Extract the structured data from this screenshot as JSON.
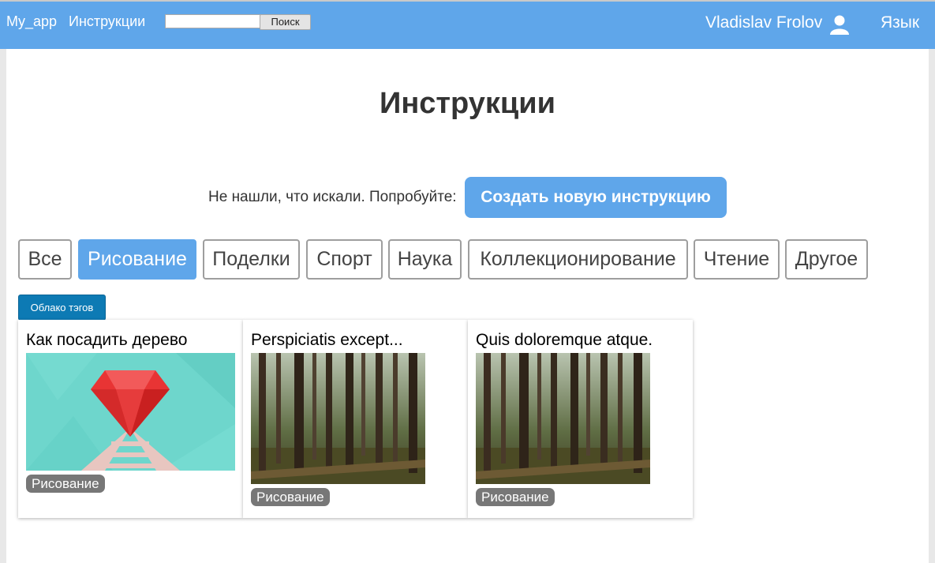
{
  "navbar": {
    "brand": "My_app",
    "instructions_link": "Инструкции",
    "search_placeholder": "",
    "search_button": "Поиск",
    "user_name": "Vladislav Frolov",
    "language": "Язык",
    "bar_color": "#5fa6ea"
  },
  "page": {
    "title": "Инструкции",
    "prompt_text": "Не нашли, что искали. Попробуйте:",
    "create_button": "Создать новую инструкцию"
  },
  "categories": [
    {
      "label": "Все",
      "active": false
    },
    {
      "label": "Рисование",
      "active": true
    },
    {
      "label": "Поделки",
      "active": false
    },
    {
      "label": "Спорт",
      "active": false
    },
    {
      "label": "Наука",
      "active": false
    },
    {
      "label": "Коллекционирование",
      "active": false
    },
    {
      "label": "Чтение",
      "active": false
    },
    {
      "label": "Другое",
      "active": false
    }
  ],
  "tag_cloud_button": "Облако тэгов",
  "cards": [
    {
      "title": "Как посадить дерево",
      "tag": "Рисование",
      "image": "ruby-gem-illustration"
    },
    {
      "title": "Perspiciatis except...",
      "tag": "Рисование",
      "image": "forest-photo"
    },
    {
      "title": "Quis doloremque atque.",
      "tag": "Рисование",
      "image": "forest-photo"
    }
  ],
  "colors": {
    "accent": "#5fa6ea",
    "cloud_button": "#0d7ab4",
    "tag": "#777777"
  }
}
